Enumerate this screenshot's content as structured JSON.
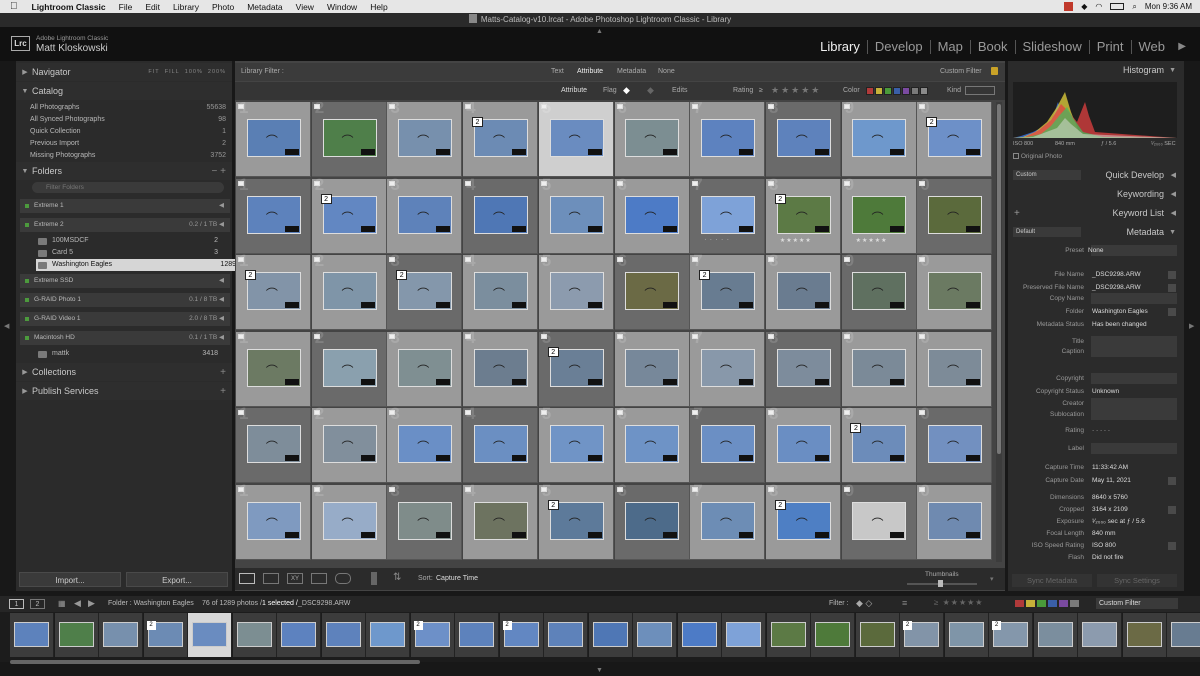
{
  "menubar": {
    "app": "Lightroom Classic",
    "items": [
      "File",
      "Edit",
      "Library",
      "Photo",
      "Metadata",
      "View",
      "Window",
      "Help"
    ],
    "right_status": "Mon 9:36 AM"
  },
  "titlebar": {
    "title": "Matts-Catalog-v10.lrcat - Adobe Photoshop Lightroom Classic - Library"
  },
  "identity": {
    "product": "Adobe Lightroom Classic",
    "user": "Matt Kloskowski",
    "logo": "Lrc"
  },
  "modules": [
    "Library",
    "Develop",
    "Map",
    "Book",
    "Slideshow",
    "Print",
    "Web"
  ],
  "active_module": "Library",
  "left_panel": {
    "navigator": {
      "title": "Navigator",
      "zoom": [
        "FIT",
        "FILL",
        "100%",
        "200%"
      ]
    },
    "catalog": {
      "title": "Catalog",
      "rows": [
        {
          "label": "All Photographs",
          "count": "55638"
        },
        {
          "label": "All Synced Photographs",
          "count": "98"
        },
        {
          "label": "Quick Collection",
          "count": "1"
        },
        {
          "label": "Previous Import",
          "count": "2"
        },
        {
          "label": "Missing Photographs",
          "count": "3752"
        }
      ]
    },
    "folders": {
      "title": "Folders",
      "search_placeholder": "Filter Folders",
      "volumes": [
        {
          "name": "Extreme 1",
          "info": ""
        },
        {
          "name": "Extreme 2",
          "info": "0.2 / 1 TB"
        },
        {
          "name": "Extreme SSD",
          "info": ""
        },
        {
          "name": "G-RAID Photo 1",
          "info": "0.1 / 8 TB"
        },
        {
          "name": "G-RAID Video 1",
          "info": "2.0 / 8 TB"
        },
        {
          "name": "Macintosh HD",
          "info": "0.1 / 1 TB"
        }
      ],
      "subfolders": [
        {
          "name": "100MSDCF",
          "count": "2"
        },
        {
          "name": "Card 5",
          "count": "3"
        },
        {
          "name": "Washington Eagles",
          "count": "1289"
        },
        {
          "name": "mattk",
          "count": "3418"
        }
      ]
    },
    "collections": {
      "title": "Collections"
    },
    "publish": {
      "title": "Publish Services"
    },
    "import_label": "Import...",
    "export_label": "Export..."
  },
  "filter_bar": {
    "title": "Library Filter :",
    "tabs": [
      "Text",
      "Attribute",
      "Metadata",
      "None"
    ],
    "active_tab": "Attribute",
    "preset": "Custom Filter",
    "attr_label": "Attribute",
    "flag_label": "Flag",
    "edits_label": "Edits",
    "rating_label": "Rating",
    "rating_op": "≥",
    "color_label": "Color",
    "kind_label": "Kind",
    "swatches": [
      "#b03a3a",
      "#c6b23a",
      "#4a9a3a",
      "#3a5fa8",
      "#7a4aa0",
      "#7a7a7a",
      "#8a8a8a"
    ]
  },
  "grid": {
    "rows": [
      [
        {
          "n": "1",
          "t": "#5a7fb4",
          "b": "",
          "s": ""
        },
        {
          "n": "2",
          "t": "#4f7f4a",
          "b": "",
          "s": ""
        },
        {
          "n": "3",
          "t": "#7790ad",
          "b": "",
          "s": ""
        },
        {
          "n": "4",
          "t": "#6c8bb4",
          "b": "2",
          "s": ""
        },
        {
          "n": "5",
          "t": "#6a8cc0",
          "b": "",
          "s": ""
        },
        {
          "n": "6",
          "t": "#7c8e92",
          "b": "",
          "s": ""
        },
        {
          "n": "7",
          "t": "#5d82bf",
          "b": "",
          "s": ""
        },
        {
          "n": "8",
          "t": "#5e82bc",
          "b": "",
          "s": ""
        },
        {
          "n": "9",
          "t": "#6e98cc",
          "b": "",
          "s": ""
        },
        {
          "n": "0",
          "t": "#6d90c8",
          "b": "2",
          "s": ""
        }
      ],
      [
        {
          "n": "1",
          "t": "#5d82bc",
          "b": "",
          "s": ""
        },
        {
          "n": "2",
          "t": "#6287c2",
          "b": "2",
          "s": ""
        },
        {
          "n": "3",
          "t": "#5e82ba",
          "b": "",
          "s": ""
        },
        {
          "n": "4",
          "t": "#4f77b5",
          "b": "",
          "s": ""
        },
        {
          "n": "5",
          "t": "#6d8fbb",
          "b": "",
          "s": ""
        },
        {
          "n": "6",
          "t": "#4d7bc6",
          "b": "",
          "s": ""
        },
        {
          "n": "7",
          "t": "#7ea2d8",
          "b": "",
          "s": "· · · · ·"
        },
        {
          "n": "8",
          "t": "#5c7a45",
          "b": "2",
          "s": "★★★★★"
        },
        {
          "n": "9",
          "t": "#4e7a3a",
          "b": "",
          "s": "★★★★★"
        },
        {
          "n": "0",
          "t": "#5b6a3c",
          "b": "",
          "s": ""
        }
      ],
      [
        {
          "n": "1",
          "t": "#8294a8",
          "b": "2",
          "s": ""
        },
        {
          "n": "2",
          "t": "#7f95a8",
          "b": "",
          "s": ""
        },
        {
          "n": "3",
          "t": "#8497ab",
          "b": "2",
          "s": ""
        },
        {
          "n": "4",
          "t": "#7b8e9e",
          "b": "",
          "s": ""
        },
        {
          "n": "5",
          "t": "#8c9bae",
          "b": "",
          "s": ""
        },
        {
          "n": "6",
          "t": "#6b6a45",
          "b": "",
          "s": ""
        },
        {
          "n": "7",
          "t": "#687c91",
          "b": "2",
          "s": ""
        },
        {
          "n": "8",
          "t": "#6a7c90",
          "b": "",
          "s": ""
        },
        {
          "n": "9",
          "t": "#5f7060",
          "b": "",
          "s": ""
        },
        {
          "n": "0",
          "t": "#6b7a62",
          "b": "",
          "s": ""
        }
      ],
      [
        {
          "n": "1",
          "t": "#6c7a63",
          "b": "",
          "s": ""
        },
        {
          "n": "2",
          "t": "#8aa0ae",
          "b": "",
          "s": ""
        },
        {
          "n": "3",
          "t": "#7f8f92",
          "b": "",
          "s": ""
        },
        {
          "n": "4",
          "t": "#6c7d8f",
          "b": "",
          "s": ""
        },
        {
          "n": "5",
          "t": "#6a7f96",
          "b": "2",
          "s": ""
        },
        {
          "n": "6",
          "t": "#77889a",
          "b": "",
          "s": ""
        },
        {
          "n": "7",
          "t": "#8898aa",
          "b": "",
          "s": ""
        },
        {
          "n": "8",
          "t": "#7d8c9c",
          "b": "",
          "s": ""
        },
        {
          "n": "9",
          "t": "#7b8a98",
          "b": "",
          "s": ""
        },
        {
          "n": "0",
          "t": "#7d8b98",
          "b": "",
          "s": ""
        }
      ],
      [
        {
          "n": "1",
          "t": "#7e8d9a",
          "b": "",
          "s": ""
        },
        {
          "n": "2",
          "t": "#818f9c",
          "b": "",
          "s": ""
        },
        {
          "n": "3",
          "t": "#6a8fc6",
          "b": "",
          "s": ""
        },
        {
          "n": "4",
          "t": "#6b8fc2",
          "b": "",
          "s": ""
        },
        {
          "n": "5",
          "t": "#7094c6",
          "b": "",
          "s": ""
        },
        {
          "n": "6",
          "t": "#6e93c6",
          "b": "",
          "s": ""
        },
        {
          "n": "7",
          "t": "#6b8fc4",
          "b": "",
          "s": ""
        },
        {
          "n": "8",
          "t": "#6a8ec3",
          "b": "",
          "s": ""
        },
        {
          "n": "9",
          "t": "#6c8cba",
          "b": "2",
          "s": ""
        },
        {
          "n": "0",
          "t": "#7290c0",
          "b": "",
          "s": ""
        }
      ],
      [
        {
          "n": "1",
          "t": "#7f9ac0",
          "b": "",
          "s": ""
        },
        {
          "n": "2",
          "t": "#97acc8",
          "b": "",
          "s": ""
        },
        {
          "n": "3",
          "t": "#7f8c8a",
          "b": "",
          "s": ""
        },
        {
          "n": "4",
          "t": "#6d7360",
          "b": "",
          "s": ""
        },
        {
          "n": "5",
          "t": "#5d7a9a",
          "b": "2",
          "s": ""
        },
        {
          "n": "6",
          "t": "#4d6b8a",
          "b": "",
          "s": ""
        },
        {
          "n": "7",
          "t": "#6d8db5",
          "b": "",
          "s": ""
        },
        {
          "n": "8",
          "t": "#4e7fc4",
          "b": "2",
          "s": ""
        },
        {
          "n": "9",
          "t": "#c8c8c8",
          "b": "",
          "s": ""
        },
        {
          "n": "0",
          "t": "#6f8ab0",
          "b": "",
          "s": ""
        }
      ]
    ],
    "cell_bg": [
      "#9a9a9a",
      "#6a6a6a"
    ],
    "selected_cell": {
      "row": 0,
      "col": 4
    }
  },
  "toolbar": {
    "sort_label": "Sort:",
    "sort_value": "Capture Time",
    "thumb_label": "Thumbnails"
  },
  "right_panel": {
    "histogram": {
      "title": "Histogram",
      "iso": "ISO 800",
      "focal": "840 mm",
      "aperture": "ƒ / 5.6",
      "shutter": "¹⁄₂₀₀₀ SEC",
      "original": "Original Photo"
    },
    "quick_develop": {
      "title": "Quick Develop",
      "preset": "Custom"
    },
    "keywording": {
      "title": "Keywording"
    },
    "keyword_list": {
      "title": "Keyword List"
    },
    "metadata": {
      "title": "Metadata",
      "preset_select": "Default",
      "preset_label": "Preset",
      "preset_value": "None",
      "rows": [
        {
          "label": "File Name",
          "value": "_DSC9298.ARW"
        },
        {
          "label": "Preserved File Name",
          "value": "_DSC9298.ARW"
        },
        {
          "label": "Copy Name",
          "value": ""
        },
        {
          "label": "Folder",
          "value": "Washington Eagles"
        },
        {
          "label": "Metadata Status",
          "value": "Has been changed"
        },
        {
          "label": "Title",
          "value": ""
        },
        {
          "label": "Caption",
          "value": ""
        },
        {
          "label": "Copyright",
          "value": ""
        },
        {
          "label": "Copyright Status",
          "value": "Unknown"
        },
        {
          "label": "Creator",
          "value": ""
        },
        {
          "label": "Sublocation",
          "value": ""
        },
        {
          "label": "Rating",
          "value": "· · · · ·"
        },
        {
          "label": "Label",
          "value": ""
        },
        {
          "label": "Capture Time",
          "value": "11:33:42 AM"
        },
        {
          "label": "Capture Date",
          "value": "May 11, 2021"
        },
        {
          "label": "Dimensions",
          "value": "8640 x 5760"
        },
        {
          "label": "Cropped",
          "value": "3164 x 2109"
        },
        {
          "label": "Exposure",
          "value": "¹⁄₂₀₀₀ sec at ƒ / 5.6"
        },
        {
          "label": "Focal Length",
          "value": "840 mm"
        },
        {
          "label": "ISO Speed Rating",
          "value": "ISO 800"
        },
        {
          "label": "Flash",
          "value": "Did not fire"
        }
      ]
    },
    "sync_metadata": "Sync Metadata",
    "sync_settings": "Sync Settings"
  },
  "filmstrip": {
    "page1": "1",
    "page2": "2",
    "source": "Folder : Washington Eagles",
    "count_text": "76 of 1289 photos /",
    "selected_text": "1 selected /",
    "file": "_DSC9298.ARW",
    "filter_label": "Filter :",
    "filter_preset": "Custom Filter",
    "thumbs": [
      "#5d82bc",
      "#4f7f4a",
      "#7790ad",
      "#6c8bb4",
      "#6a8cc0",
      "#7c8e92",
      "#5d82bf",
      "#5e82bc",
      "#6e98cc",
      "#6d90c8",
      "#5d82bc",
      "#6287c2",
      "#5e82ba",
      "#4f77b5",
      "#6d8fbb",
      "#4d7bc6",
      "#7ea2d8",
      "#5c7a45",
      "#4e7a3a",
      "#5b6a3c",
      "#8294a8",
      "#7f95a8",
      "#8497ab",
      "#7b8e9e",
      "#8c9bae",
      "#6b6a45",
      "#687c91"
    ],
    "badges": [
      "",
      "",
      "",
      "2",
      "",
      "",
      "",
      "",
      "",
      "2",
      "",
      "2",
      "",
      "",
      "",
      "",
      "",
      "",
      "",
      "",
      "2",
      "",
      "2",
      "",
      "",
      "",
      ""
    ]
  }
}
